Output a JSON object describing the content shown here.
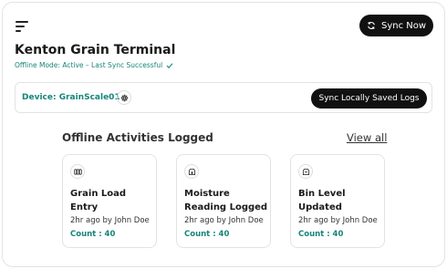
{
  "header": {
    "sync_now_label": "Sync Now",
    "title": "Kenton Grain Terminal",
    "status_text": "Offline Mode: Active – Last Sync Successful"
  },
  "device": {
    "label": "Device: GrainScale01",
    "sync_logs_label": "Sync Locally Saved Logs"
  },
  "activities": {
    "section_title": "Offline Activities Logged",
    "view_all_label": "View all",
    "items": [
      {
        "icon": "grain-sacks-icon",
        "title": "Grain Load Entry",
        "meta": "2hr ago by John Doe",
        "count": "Count : 40"
      },
      {
        "icon": "moisture-box-icon",
        "title": "Moisture Reading Logged",
        "meta": "2hr ago by John Doe",
        "count": "Count : 40"
      },
      {
        "icon": "bin-icon",
        "title": "Bin Level Updated",
        "meta": "2hr ago by John Doe",
        "count": "Count : 40"
      }
    ]
  },
  "colors": {
    "accent": "#16857a",
    "button_bg": "#111111"
  }
}
